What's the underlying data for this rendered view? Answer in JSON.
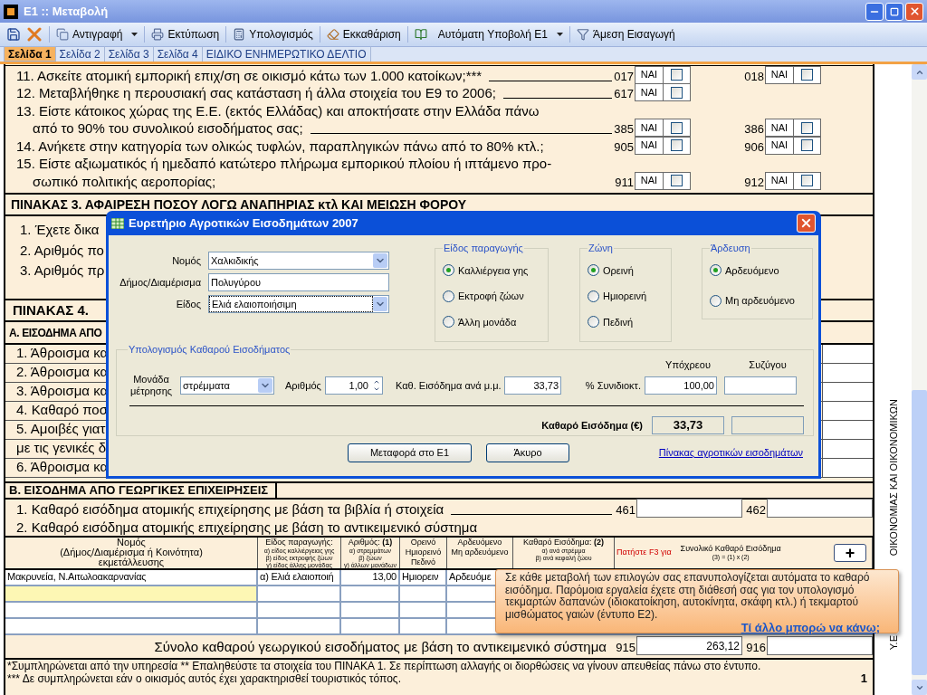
{
  "window": {
    "title": "E1 :: Μεταβολή"
  },
  "toolbar": [
    {
      "label": "Αντιγραφή",
      "dropdown": true
    },
    {
      "label": "Εκτύπωση",
      "dropdown": false
    },
    {
      "label": "Υπολογισμός",
      "dropdown": false
    },
    {
      "label": "Εκκαθάριση",
      "dropdown": false
    },
    {
      "label": "Αυτόματη Υποβολή Ε1",
      "dropdown": true
    },
    {
      "label": "Άμεση Εισαγωγή",
      "dropdown": false
    }
  ],
  "tabs": [
    {
      "label": "Σελίδα 1",
      "selected": true
    },
    {
      "label": "Σελίδα 2",
      "selected": false
    },
    {
      "label": "Σελίδα 3",
      "selected": false
    },
    {
      "label": "Σελίδα 4",
      "selected": false
    },
    {
      "label": "ΕΙΔΙΚΟ ΕΝΗΜΕΡΩΤΙΚΟ ΔΕΛΤΙΟ",
      "selected": false
    }
  ],
  "form": {
    "questions": [
      {
        "kind": "first",
        "text": "11. Ασκείτε ατομική εμπορική επιχ/ση σε οικισμό κάτω των 1.000 κατοίκων;***",
        "leader": true,
        "slots": [
          {
            "code": "017",
            "label": "ΝΑΙ",
            "checked": false
          },
          {
            "code": "018",
            "label": "ΝΑΙ",
            "checked": false
          }
        ]
      },
      {
        "kind": "first",
        "text": "12. Μεταβλήθηκε η περουσιακή σας κατάσταση ή άλλα στοιχεία του Ε9 το 2006;",
        "leader": true,
        "slots": [
          {
            "code": "617",
            "label": "ΝΑΙ",
            "checked": false
          }
        ]
      },
      {
        "kind": "first",
        "text": "13. Είστε κάτοικος χώρας της Ε.Ε. (εκτός Ελλάδας) και αποκτήσατε στην Ελλάδα πάνω",
        "leader": false
      },
      {
        "kind": "continuation",
        "text": "από το 90% του συνολικού εισοδήματος σας;",
        "leader": true,
        "slots": [
          {
            "code": "385",
            "label": "ΝΑΙ",
            "checked": false
          },
          {
            "code": "386",
            "label": "ΝΑΙ",
            "checked": false
          }
        ]
      },
      {
        "kind": "first",
        "text": "14. Ανήκετε στην κατηγορία των ολικώς τυφλών, παραπληγικών πάνω από το 80% κτλ.;",
        "leader": false,
        "slots": [
          {
            "code": "905",
            "label": "ΝΑΙ",
            "checked": false
          },
          {
            "code": "906",
            "label": "ΝΑΙ",
            "checked": false
          }
        ]
      },
      {
        "kind": "first",
        "text": "15. Είστε αξιωματικός ή ημεδαπό κατώτερο πλήρωμα εμπορικού πλοίου ή ιπτάμενο προ-",
        "leader": false
      },
      {
        "kind": "continuation",
        "text": "σωπικό πολιτικής αεροπορίας;",
        "leader": false,
        "slots": [
          {
            "code": "911",
            "label": "ΝΑΙ",
            "checked": false
          },
          {
            "code": "912",
            "label": "ΝΑΙ",
            "checked": false
          }
        ]
      }
    ],
    "table3": {
      "title": "ΠΙΝΑΚΑΣ 3. ΑΦΑΙΡΕΣΗ ΠΟΣΟΥ ΛΟΓΩ ΑΝΑΠΗΡΙΑΣ κτλ ΚΑΙ ΜΕΙΩΣΗ ΦΟΡΟΥ",
      "lines": [
        "1. Έχετε δικα",
        "2. Αριθμός πο",
        "3. Αριθμός πρ"
      ]
    },
    "table4": {
      "title": "ΠΙΝΑΚΑΣ 4.",
      "section_a": {
        "title": "Α. ΕΙΣΟΔΗΜΑ ΑΠΟ",
        "lines": [
          "1. Άθροισμα κα",
          "2. Άθροισμα κα",
          "3. Άθροισμα κα",
          "4. Καθαρό ποσ",
          "5. Αμοιβές γιατ",
          "με τις γενικές δ",
          "6. Άθροισμα κα"
        ]
      },
      "section_b": {
        "title": "Β. ΕΙΣΟΔΗΜΑ ΑΠΟ ΓΕΩΡΓΙΚΕΣ ΕΠΙΧΕΙΡΗΣΕΙΣ",
        "lines": [
          {
            "text": "1. Καθαρό εισόδημα ατομικής επιχείρησης με βάση τα βιβλία ή στοιχεία",
            "leader": true,
            "fields": [
              {
                "code": "461"
              },
              {
                "code": "462"
              }
            ]
          },
          {
            "text": "2. Καθαρό εισόδημα ατομικής επιχείρησης με βάση το αντικειμενικό σύστημα",
            "leader": false
          }
        ],
        "table": {
          "columns": [
            {
              "kind": "plain",
              "lines": [
                "Νομός",
                "(Δήμος/Διαμέρισμα ή Κοινότητα)",
                "εκμετάλλευσης"
              ]
            },
            {
              "kind": "subitems",
              "lines": [
                "Είδος παραγωγής:",
                "α) είδος καλλιέργειας γης",
                "β) είδος εκτροφής ζώων",
                "γ) είδος άλλης μονάδας"
              ]
            },
            {
              "kind": "subitems",
              "lines": [
                "Αριθμός: **(1)**",
                "α) στρεμμάτων",
                "β) ζώων",
                "γ) άλλων μονάδων"
              ]
            },
            {
              "kind": "plain",
              "lines": [
                "Ορεινό",
                "Ημιορεινό",
                "Πεδινό"
              ]
            },
            {
              "kind": "plain",
              "lines": [
                "Αρδευόμενο",
                "Μη αρδευόμενο"
              ]
            },
            {
              "kind": "subitems",
              "lines": [
                "Καθαρό Εισόδημα: **(2)**",
                "α) ανά στρέμμα",
                "β) ανά κεφαλή ζώου"
              ]
            },
            {
              "kind": "total",
              "note": "Πατήστε F3 για",
              "lines": [
                "Συνολικό  Καθαρό Εισόδημα",
                "(3) = (1) x (2)"
              ]
            }
          ],
          "add_button": "+",
          "rows": [
            {
              "selected": false,
              "cells": [
                "Μακρυνεία, Ν.Αιτωλοακαρνανίας",
                "α) Ελιά ελαιοποιή",
                "13,00",
                "Ημιορειν",
                "Αρδευόμε"
              ]
            },
            {
              "selected": true
            },
            {
              "selected": false
            },
            {
              "selected": false
            }
          ],
          "total": {
            "text": "Σύνολο καθαρού γεωργικού εισοδήματος με βάση το αντικειμενικό σύστημα",
            "fields": [
              {
                "code": "915",
                "value": "263,12"
              },
              {
                "code": "916"
              }
            ]
          }
        }
      }
    },
    "footnotes": [
      "*Συμπληρώνεται από την υπηρεσία  ** Επαληθεύστε τα στοιχεία του ΠΙΝΑΚΑ 1. Σε περίπτωση αλλαγής οι διορθώσεις να γίνουν απευθείας πάνω στο έντυπο.",
      "*** Δε συμπληρώνεται εάν ο οικισμός αυτός έχει χαρακτηρισθεί τουριστικός τόπος."
    ],
    "page_number": "1",
    "side_text": [
      "ΟΙΚΟΝΟΜΙΑΣ ΚΑΙ ΟΙΚΟΝΟΜΙΚΩΝ",
      "Υ.Ε"
    ]
  },
  "dialog": {
    "title": "Ευρετήριο Αγροτικών Εισοδημάτων 2007",
    "location": [
      {
        "kind": "select",
        "label": "Νομός",
        "value": "Χαλκιδικής",
        "focused": false
      },
      {
        "kind": "text",
        "label": "Δήμος/Διαμέρισμα",
        "value": "Πολυγύρου",
        "focused": false
      },
      {
        "kind": "select",
        "label": "Είδος",
        "value": "Ελιά ελαιοποιήσιμη",
        "focused": true
      }
    ],
    "groups": [
      {
        "title": "Είδος παραγωγής",
        "options": [
          {
            "label": "Καλλιέργεια γης",
            "selected": true
          },
          {
            "label": "Εκτροφή ζώων",
            "selected": false
          },
          {
            "label": "Άλλη μονάδα",
            "selected": false
          }
        ]
      },
      {
        "title": "Ζώνη",
        "options": [
          {
            "label": "Ορεινή",
            "selected": true
          },
          {
            "label": "Ημιορεινή",
            "selected": false
          },
          {
            "label": "Πεδινή",
            "selected": false
          }
        ]
      },
      {
        "title": "Άρδευση",
        "options": [
          {
            "label": "Αρδευόμενο",
            "selected": true
          },
          {
            "label": "Μη αρδευόμενο",
            "selected": false
          }
        ]
      }
    ],
    "calculation": {
      "title": "Υπολογισμός Καθαρού Εισοδήματος",
      "unit_label": "Μονάδα μέτρησης",
      "unit_value": "στρέμματα",
      "count_label": "Αριθμός",
      "count_value": "1,00",
      "rate_label": "Καθ. Εισόδημα ανά μ.μ.",
      "rate_value": "33,73",
      "share_label": "% Συνιδιοκτ.",
      "columns": [
        "Υπόχρεου",
        "Συζύγου"
      ],
      "share_values": [
        "100,00"
      ],
      "total_label": "Καθαρό Εισόδημα (€)",
      "total_values": [
        "33,73"
      ]
    },
    "buttons": [
      "Μεταφορά στο Ε1",
      "Άκυρο"
    ],
    "link": "Πίνακας αγροτικών εισοδημάτων"
  },
  "tooltip": {
    "text": "Σε κάθε μεταβολή των επιλογών σας επανυπολογίζεται αυτόματα το καθαρό εισόδημα. Παρόμοια εργαλεία έχετε στη διάθεσή σας για τον υπολογισμό τεκμαρτών δαπανών (ιδιοκατοίκηση, αυτοκίνητα, σκάφη κτλ.) ή τεκμαρτού μισθώματος γαιών (έντυπο Ε2).",
    "link": "Τί άλλο μπορώ να κάνω;"
  }
}
